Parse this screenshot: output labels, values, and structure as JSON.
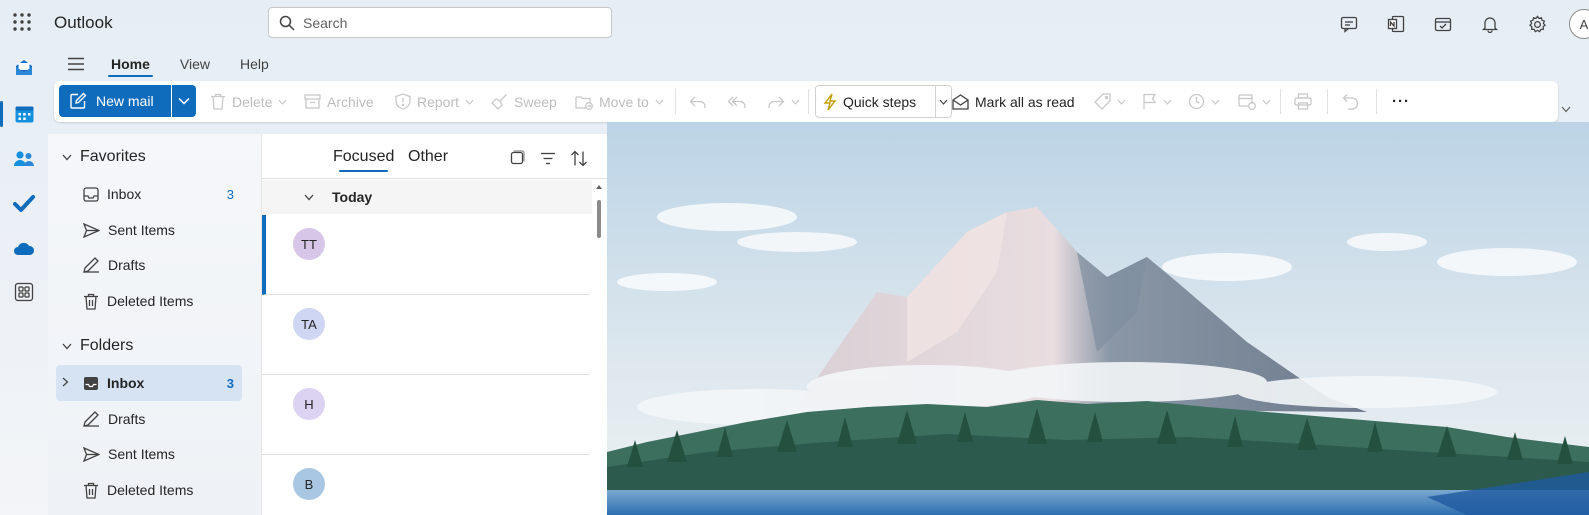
{
  "app": {
    "name": "Outlook"
  },
  "search": {
    "placeholder": "Search"
  },
  "profile": {
    "initial": "A"
  },
  "menu_tabs": [
    "Home",
    "View",
    "Help"
  ],
  "ribbon": {
    "new_mail": "New mail",
    "delete": "Delete",
    "archive": "Archive",
    "report": "Report",
    "sweep": "Sweep",
    "move_to": "Move to",
    "quick_steps": "Quick steps",
    "mark_all_read": "Mark all as read",
    "more": "···"
  },
  "favorites": {
    "title": "Favorites",
    "items": [
      {
        "label": "Inbox",
        "count": "3"
      },
      {
        "label": "Sent Items",
        "count": ""
      },
      {
        "label": "Drafts",
        "count": ""
      },
      {
        "label": "Deleted Items",
        "count": ""
      }
    ]
  },
  "folders": {
    "title": "Folders",
    "items": [
      {
        "label": "Inbox",
        "count": "3"
      },
      {
        "label": "Drafts",
        "count": ""
      },
      {
        "label": "Sent Items",
        "count": ""
      },
      {
        "label": "Deleted Items",
        "count": ""
      }
    ]
  },
  "message_list": {
    "focused": "Focused",
    "other": "Other",
    "group": "Today",
    "messages": [
      {
        "initials": "TT",
        "color": "#d7c6e8"
      },
      {
        "initials": "TA",
        "color": "#cfd6f3"
      },
      {
        "initials": "H",
        "color": "#dcd3f2"
      },
      {
        "initials": "B",
        "color": "#a9c7e3"
      }
    ]
  },
  "colors": {
    "accent": "#0f6cbd",
    "selected_folder": "#d6e3f3"
  }
}
